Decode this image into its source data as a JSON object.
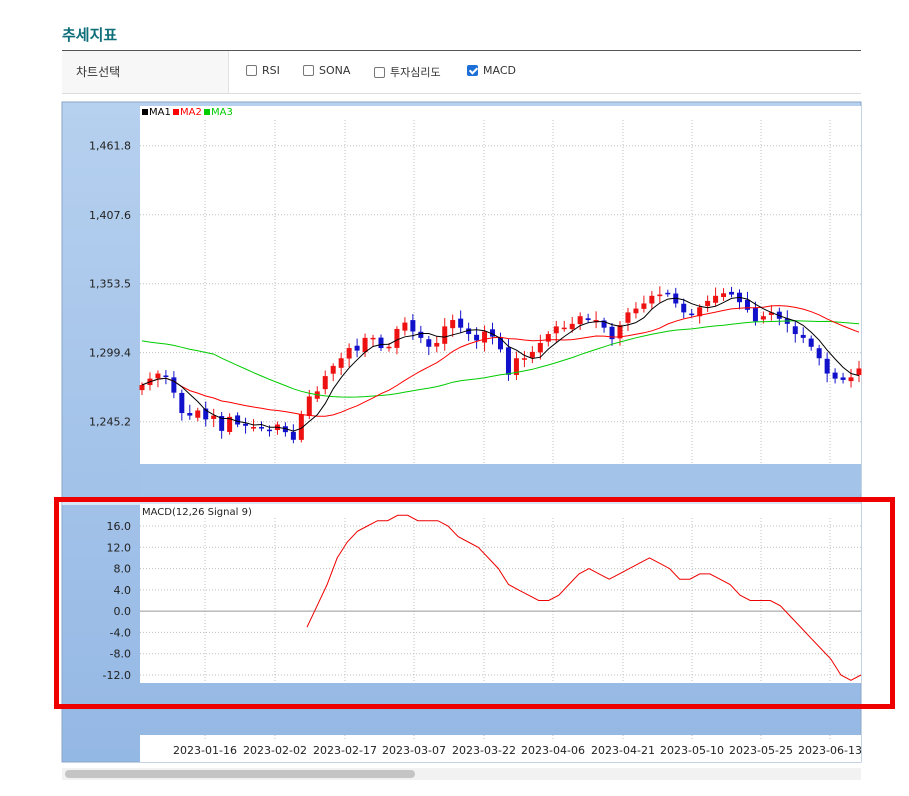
{
  "page": {
    "title": "추세지표",
    "selector_label": "차트선택",
    "options": [
      {
        "label": "RSI",
        "checked": false
      },
      {
        "label": "SONA",
        "checked": false
      },
      {
        "label": "투자심리도",
        "checked": false
      },
      {
        "label": "MACD",
        "checked": true
      }
    ]
  },
  "colors": {
    "panel_blue": "#a4c3e8",
    "ma1": "#000000",
    "ma2": "#ff0000",
    "ma3": "#00cc00",
    "up_candle": "#ee1111",
    "down_candle": "#1111cc",
    "macd_line": "#ee0000",
    "highlight": "#ee0000",
    "title": "#0e6e7a"
  },
  "chart_data": [
    {
      "type": "candlestick",
      "legend": [
        "MA1",
        "MA2",
        "MA3"
      ],
      "ylim": [
        1212,
        1482
      ],
      "yticks": [
        "1,461.8",
        "1,407.6",
        "1,353.5",
        "1,299.4",
        "1,245.2"
      ],
      "ytick_values": [
        1461.8,
        1407.6,
        1353.5,
        1299.4,
        1245.2
      ],
      "xticks": [
        "2023-01-16",
        "2023-02-02",
        "2023-02-17",
        "2023-03-07",
        "2023-03-22",
        "2023-04-06",
        "2023-04-21",
        "2023-05-10",
        "2023-05-25",
        "2023-06-13"
      ],
      "grid": true,
      "close": [
        1274,
        1279,
        1283,
        1281,
        1268,
        1252,
        1250,
        1254,
        1247,
        1250,
        1238,
        1249,
        1243,
        1242,
        1241,
        1240,
        1238,
        1243,
        1237,
        1231,
        1251,
        1265,
        1269,
        1281,
        1289,
        1295,
        1303,
        1301,
        1311,
        1311,
        1303,
        1304,
        1318,
        1323,
        1316,
        1311,
        1304,
        1307,
        1320,
        1325,
        1319,
        1314,
        1309,
        1316,
        1312,
        1302,
        1282,
        1295,
        1295,
        1300,
        1307,
        1314,
        1320,
        1319,
        1322,
        1328,
        1325,
        1325,
        1319,
        1310,
        1321,
        1331,
        1334,
        1338,
        1344,
        1345,
        1346,
        1338,
        1331,
        1329,
        1335,
        1340,
        1344,
        1346,
        1345,
        1339,
        1333,
        1324,
        1328,
        1331,
        1326,
        1322,
        1314,
        1311,
        1304,
        1295,
        1283,
        1279,
        1278,
        1280,
        1287
      ]
    },
    {
      "type": "line",
      "title": "MACD(12,26 Signal 9)",
      "series": [
        {
          "name": "MACD",
          "values": [
            -3,
            1,
            5,
            10,
            13,
            15,
            16,
            17,
            17,
            18,
            18,
            17,
            17,
            17,
            16,
            14,
            13,
            12,
            10,
            8,
            5,
            4,
            3,
            2,
            2,
            3,
            5,
            7,
            8,
            7,
            6,
            7,
            8,
            9,
            10,
            9,
            8,
            6,
            6,
            7,
            7,
            6,
            5,
            3,
            2,
            2,
            2,
            1,
            -1,
            -3,
            -5,
            -7,
            -9,
            -12,
            -13,
            -12
          ]
        }
      ],
      "ylim": [
        -13.5,
        17.5
      ],
      "yticks": [
        "16.0",
        "12.0",
        "8.0",
        "4.0",
        "0.0",
        "-4.0",
        "-8.0",
        "-12.0"
      ],
      "ytick_values": [
        16,
        12,
        8,
        4,
        0,
        -4,
        -8,
        -12
      ],
      "grid": true
    }
  ]
}
